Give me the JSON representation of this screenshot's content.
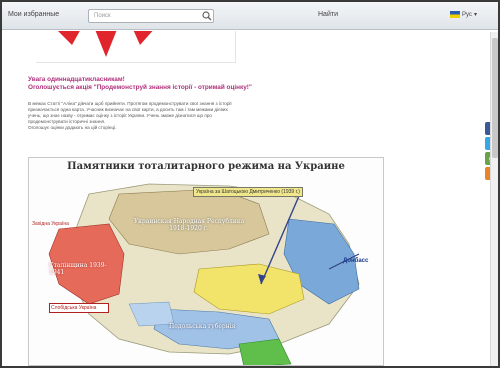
{
  "toolbar": {
    "favorites": "Мои избранные",
    "search_placeholder": "Поиск",
    "tools_label": "Найти",
    "lang_label": "Рус"
  },
  "article": {
    "heading_line1": "Увага одиннадцатикласникам!",
    "heading_line2": "Оголошується акція \"Продемонструй знання історії - отримай оцінку!\"",
    "body_lines": [
      "В межах Статті \"Аліна\" дівчати щоб прийняти. Протягом продемонструвати свої знання з історії",
      "призначається одна карта. Учасник визначає на свої карти, а досить там і там межами дієвих",
      "учень, що знає назву - отримає оцінку з історії України. Учень зможе дізнатися що про",
      "продемонструвати історичні знання.",
      "Оголошує оцінки додають на цій сторінці."
    ]
  },
  "map": {
    "title": "Памятники тоталитарного режима на Украине",
    "labels": [
      "Україна за Шатоцькою Дмитриченко (1939 г.)",
      "Украинская Народная Республика 1918-1920 г.",
      "Західна Україна",
      "Сталінщина 1939-1941",
      "Донбасс",
      "Слобідська Україна",
      "Подольська губернія"
    ]
  },
  "social": {
    "fb": "f",
    "tw": "t",
    "g": "g",
    "rss": "r"
  },
  "colors": {
    "accent_magenta": "#b0307c",
    "toolbar_top": "#f4f6f8",
    "toolbar_bottom": "#dfe4e9",
    "logo_red": "#e0262c"
  }
}
